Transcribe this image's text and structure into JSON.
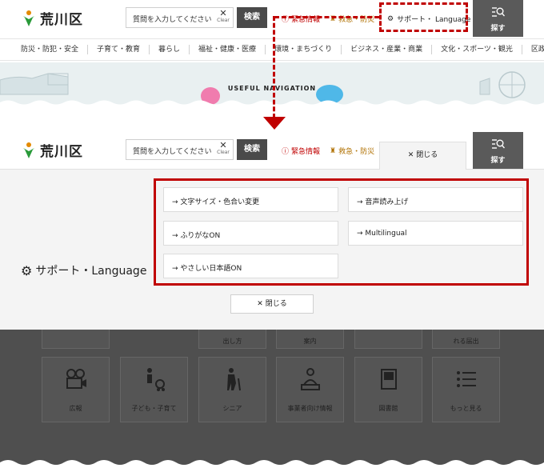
{
  "header": {
    "logo_text": "荒川区",
    "search_placeholder": "質問を入力してください",
    "clear_label": "Clear",
    "search_button": "検索",
    "emergency_label": "緊急情報",
    "rescue_label": "救急・防災",
    "support_label": "サポート・ Language",
    "find_label": "探す"
  },
  "nav": {
    "items": [
      "防災・防犯・安全",
      "子育て・教育",
      "暮らし",
      "福祉・健康・医療",
      "環境・まちづくり",
      "ビジネス・産業・商業",
      "文化・スポーツ・観光",
      "区政情報"
    ]
  },
  "banner": {
    "title": "USEFUL NAVIGATION"
  },
  "support_menu": {
    "close_tab_label": "閉じる",
    "section_title": "サポート・Language",
    "items": [
      "→ 文字サイズ・色合い変更",
      "→ 音声読み上げ",
      "→ ふりがなON",
      "→ Multilingual",
      "→ やさしい日本語ON"
    ],
    "close_button": "閉じる"
  },
  "background_tiles": {
    "top_row": [
      "出し方",
      "案内",
      "れる届出"
    ],
    "items": [
      "広報",
      "子ども・子育て",
      "シニア",
      "事業者向け情報",
      "図書館",
      "もっと見る"
    ]
  },
  "colors": {
    "highlight": "#c00000",
    "dark_button": "#4a4a4a",
    "overlay": "#4f4f4f"
  }
}
